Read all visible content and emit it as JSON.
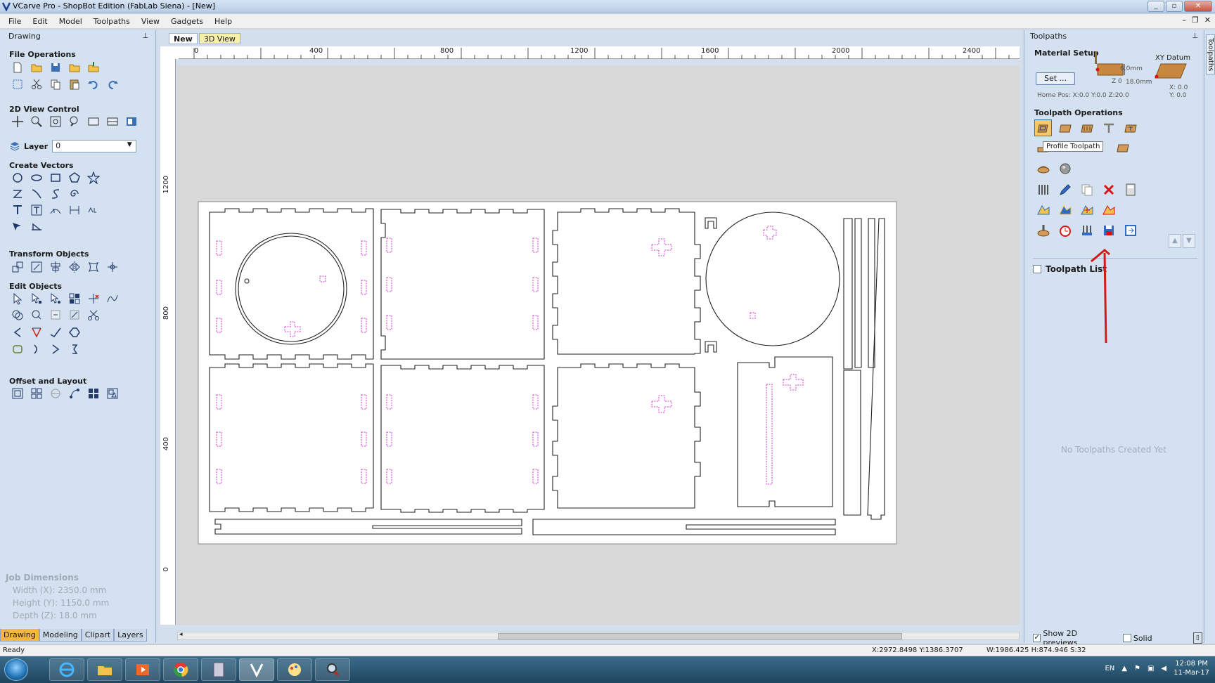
{
  "window": {
    "title": "VCarve Pro - ShopBot Edition (FabLab Siena) - [New]"
  },
  "menu": [
    "File",
    "Edit",
    "Model",
    "Toolpaths",
    "View",
    "Gadgets",
    "Help"
  ],
  "left_panel": {
    "title": "Drawing",
    "sections": {
      "file_ops": "File Operations",
      "view2d": "2D View Control",
      "create": "Create Vectors",
      "transform": "Transform Objects",
      "edit": "Edit Objects",
      "offset": "Offset and Layout"
    },
    "layer_label": "Layer",
    "layer_value": "0",
    "job": {
      "heading": "Job Dimensions",
      "width": "Width  (X): 2350.0 mm",
      "height": "Height (Y): 1150.0 mm",
      "depth": "Depth  (Z): 18.0 mm"
    },
    "tabs": [
      "Drawing",
      "Modeling",
      "Clipart",
      "Layers"
    ]
  },
  "doc_tabs": [
    "New",
    "3D View"
  ],
  "ruler": {
    "top": [
      "0",
      "400",
      "800",
      "1200",
      "1600",
      "2000",
      "2400"
    ],
    "left": [
      "1200",
      "800",
      "400",
      "0"
    ]
  },
  "right_panel": {
    "title": "Toolpaths",
    "material_setup": "Material Setup",
    "set_label": "Set ...",
    "z0": "Z 0",
    "top_offset": "6.0mm",
    "thickness": "18.0mm",
    "home_pos": "Home Pos:  X:0.0 Y:0.0 Z:20.0",
    "xy_datum": "XY Datum",
    "datum_x": "X: 0.0",
    "datum_y": "Y: 0.0",
    "toolpath_ops": "Toolpath Operations",
    "tooltip": "Profile Toolpath",
    "toolpath_list": "Toolpath List",
    "empty_msg": "No Toolpaths Created Yet",
    "show_previews": "Show 2D previews",
    "solid": "Solid"
  },
  "side_strip": "Toolpaths",
  "status": {
    "ready": "Ready",
    "coords": "X:2972.8498 Y:1386.3707",
    "size": "W:1986.425  H:874.946  S:32"
  },
  "tray": {
    "lang": "EN",
    "time": "12:08 PM",
    "date": "11-Mar-17"
  },
  "colors": {
    "panel": "#d4e1f0",
    "accent_tab": "#f7b63d",
    "pocket_lines": "#d63ad6",
    "annotation_arrow": "#d11a1a"
  }
}
